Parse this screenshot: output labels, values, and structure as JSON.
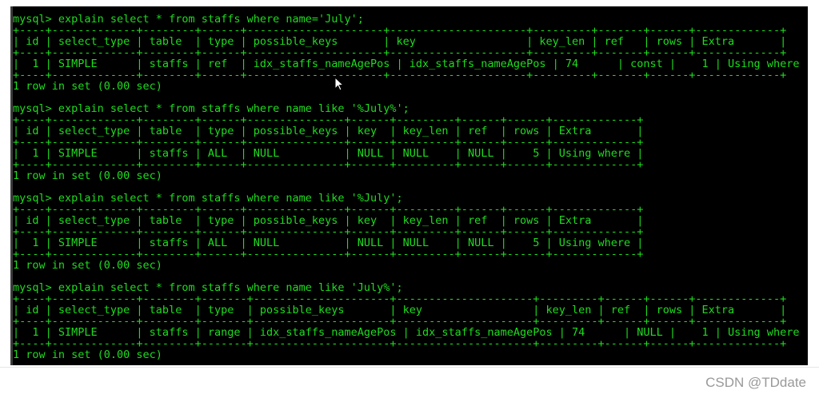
{
  "terminal": {
    "lines": [
      "mysql> explain select * from staffs where name='July';",
      "+----+-------------+--------+------+---------------------+---------------------+---------+-------+------+-------------+",
      "| id | select_type | table  | type | possible_keys       | key                 | key_len | ref   | rows | Extra       |",
      "+----+-------------+--------+------+---------------------+---------------------+---------+-------+------+-------------+",
      "|  1 | SIMPLE      | staffs | ref  | idx_staffs_nameAgePos | idx_staffs_nameAgePos | 74      | const |    1 | Using where |",
      "+----+-------------+--------+------+---------------------+---------------------+---------+-------+------+-------------+",
      "1 row in set (0.00 sec)",
      "",
      "mysql> explain select * from staffs where name like '%July%';",
      "+----+-------------+--------+------+---------------+------+---------+------+------+-------------+",
      "| id | select_type | table  | type | possible_keys | key  | key_len | ref  | rows | Extra       |",
      "+----+-------------+--------+------+---------------+------+---------+------+------+-------------+",
      "|  1 | SIMPLE      | staffs | ALL  | NULL          | NULL | NULL    | NULL |    5 | Using where |",
      "+----+-------------+--------+------+---------------+------+---------+------+------+-------------+",
      "1 row in set (0.00 sec)",
      "",
      "mysql> explain select * from staffs where name like '%July';",
      "+----+-------------+--------+------+---------------+------+---------+------+------+-------------+",
      "| id | select_type | table  | type | possible_keys | key  | key_len | ref  | rows | Extra       |",
      "+----+-------------+--------+------+---------------+------+---------+------+------+-------------+",
      "|  1 | SIMPLE      | staffs | ALL  | NULL          | NULL | NULL    | NULL |    5 | Using where |",
      "+----+-------------+--------+------+---------------+------+---------+------+------+-------------+",
      "1 row in set (0.00 sec)",
      "",
      "mysql> explain select * from staffs where name like 'July%';",
      "+----+-------------+--------+-------+---------------------+---------------------+---------+------+------+-------------+",
      "| id | select_type | table  | type  | possible_keys       | key                 | key_len | ref  | rows | Extra       |",
      "+----+-------------+--------+-------+---------------------+---------------------+---------+------+------+-------------+",
      "|  1 | SIMPLE      | staffs | range | idx_staffs_nameAgePos | idx_staffs_nameAgePos | 74      | NULL |    1 | Using where |",
      "+----+-------------+--------+-------+---------------------+---------------------+---------+------+------+-------------+",
      "1 row in set (0.00 sec)"
    ]
  },
  "watermark": "CSDN @TDdate",
  "colors": {
    "terminal_text": "#1edc1e",
    "terminal_bg": "#000000"
  },
  "icons": {
    "cursor": "mouse-pointer-icon"
  }
}
